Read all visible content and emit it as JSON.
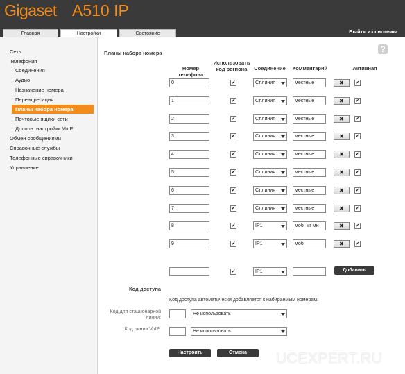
{
  "header": {
    "brand": "Gigaset",
    "model": "A510 IP",
    "tabs": [
      {
        "label": "Главная"
      },
      {
        "label": "Настройки"
      },
      {
        "label": "Состояние"
      }
    ],
    "logout": "Выйти из системы"
  },
  "sidebar": {
    "items": [
      {
        "label": "Сеть"
      },
      {
        "label": "Телефония"
      },
      {
        "label": "Соединения"
      },
      {
        "label": "Аудио"
      },
      {
        "label": "Назначение номера"
      },
      {
        "label": "Переадресация"
      },
      {
        "label": "Планы набора номера"
      },
      {
        "label": "Почтовые ящики сети"
      },
      {
        "label": "Дополн. настройки VoIP"
      },
      {
        "label": "Обмен сообщениями"
      },
      {
        "label": "Справочные службы"
      },
      {
        "label": "Телефонные справочники"
      },
      {
        "label": "Управление"
      }
    ]
  },
  "main": {
    "help": "?",
    "section_title": "Планы набора номера",
    "columns": {
      "number": "Номер телефона",
      "region": "Использовать код региона",
      "connection": "Соединение",
      "comment": "Комментарий",
      "active": "Активная"
    },
    "rows": [
      {
        "number": "0",
        "region": "✔",
        "connection": "Ст.линия",
        "comment": "местные",
        "delete": "✖",
        "active": "✔"
      },
      {
        "number": "1",
        "region": "✔",
        "connection": "Ст.линия",
        "comment": "местные",
        "delete": "✖",
        "active": "✔"
      },
      {
        "number": "2",
        "region": "✔",
        "connection": "Ст.линия",
        "comment": "местные",
        "delete": "✖",
        "active": "✔"
      },
      {
        "number": "3",
        "region": "✔",
        "connection": "Ст.линия",
        "comment": "местные",
        "delete": "✖",
        "active": "✔"
      },
      {
        "number": "4",
        "region": "✔",
        "connection": "Ст.линия",
        "comment": "местные",
        "delete": "✖",
        "active": "✔"
      },
      {
        "number": "5",
        "region": "✔",
        "connection": "Ст.линия",
        "comment": "местные",
        "delete": "✖",
        "active": "✔"
      },
      {
        "number": "6",
        "region": "✔",
        "connection": "Ст.линия",
        "comment": "местные",
        "delete": "✖",
        "active": "✔"
      },
      {
        "number": "7",
        "region": "✔",
        "connection": "Ст.линия",
        "comment": "местные",
        "delete": "✖",
        "active": "✔"
      },
      {
        "number": "8",
        "region": "✔",
        "connection": "IP1",
        "comment": "моб, мг мн",
        "delete": "✖",
        "active": "✔"
      },
      {
        "number": "9",
        "region": "✔",
        "connection": "IP1",
        "comment": "моб",
        "delete": "✖",
        "active": "✔"
      }
    ],
    "new_row": {
      "number": "",
      "region": "✔",
      "connection": "IP1",
      "comment": "",
      "add_label": "Добавить"
    },
    "access_code": {
      "title": "Код доступа",
      "description": "Код доступа автоматически добавляется к набираемым номерам.",
      "fixed_label": "Код для стационарной линии:",
      "fixed_code": "",
      "fixed_option": "Не использовать",
      "voip_label": "Код линии VoIP:",
      "voip_code": "",
      "voip_option": "Не использовать"
    },
    "buttons": {
      "apply": "Настроить",
      "cancel": "Отмена"
    }
  },
  "watermark": "UCEXPERT.RU"
}
